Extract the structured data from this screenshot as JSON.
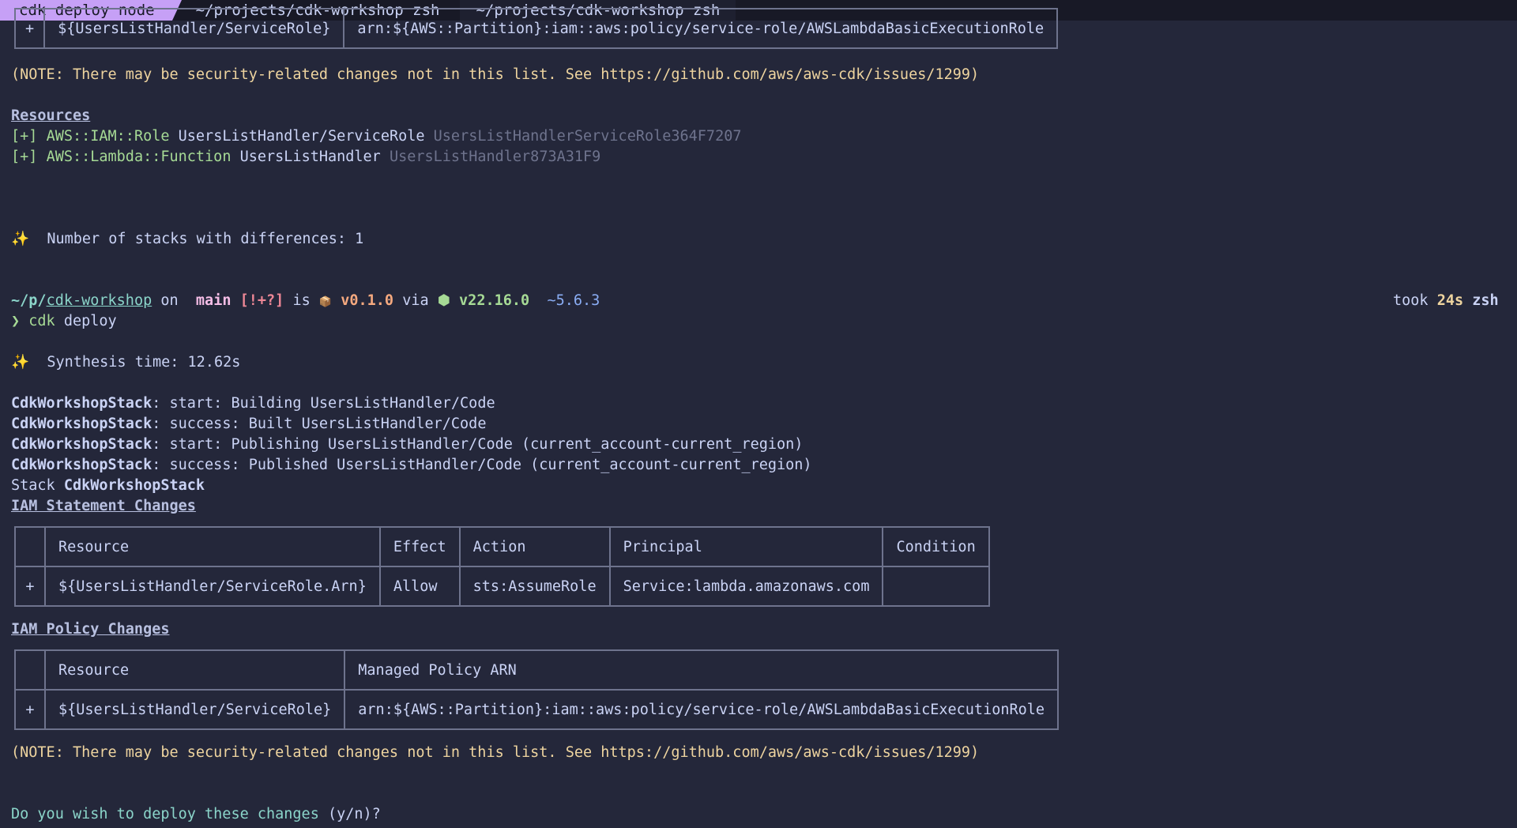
{
  "tabs": [
    {
      "label": "cdk deploy node",
      "active": true
    },
    {
      "label": "~/projects/cdk-workshop zsh",
      "active": false
    },
    {
      "label": "~/projects/cdk-workshop zsh",
      "active": false
    }
  ],
  "top_partial_row": {
    "plus": "+",
    "resource": "${UsersListHandler/ServiceRole}",
    "arn": "arn:${AWS::Partition}:iam::aws:policy/service-role/AWSLambdaBasicExecutionRole"
  },
  "note": "(NOTE: There may be security-related changes not in this list. See https://github.com/aws/aws-cdk/issues/1299)",
  "resources": {
    "heading": "Resources",
    "items": [
      {
        "marker": "[+]",
        "type": "AWS::IAM::Role",
        "name": "UsersListHandler/ServiceRole",
        "logical_id": "UsersListHandlerServiceRole364F7207"
      },
      {
        "marker": "[+]",
        "type": "AWS::Lambda::Function",
        "name": "UsersListHandler",
        "logical_id": "UsersListHandler873A31F9"
      }
    ]
  },
  "stacks_diff": {
    "icon": "✨",
    "text": "Number of stacks with differences: 1"
  },
  "prompt": {
    "dir_prefix": "~/p/",
    "dir_name": "cdk-workshop",
    "on": "on",
    "branch_icon": "",
    "branch": "main",
    "git_status": "[!+?]",
    "is": "is",
    "pkg_icon": "📦",
    "pkg_version": "v0.1.0",
    "via": "via",
    "node_icon": "⬢",
    "node_version": "v22.16.0",
    "ts_icon": "",
    "ts_version": "~5.6.3",
    "took_label": "took",
    "took_value": "24s",
    "shell": "zsh"
  },
  "command": {
    "caret": "❯",
    "cmd": "cdk",
    "args": "deploy"
  },
  "synthesis": {
    "icon": "✨",
    "text": "Synthesis time: 12.62s"
  },
  "log_lines": [
    {
      "stack": "CdkWorkshopStack",
      "text": ": start: Building UsersListHandler/Code"
    },
    {
      "stack": "CdkWorkshopStack",
      "text": ": success: Built UsersListHandler/Code"
    },
    {
      "stack": "CdkWorkshopStack",
      "text": ": start: Publishing UsersListHandler/Code (current_account-current_region)"
    },
    {
      "stack": "CdkWorkshopStack",
      "text": ": success: Published UsersListHandler/Code (current_account-current_region)"
    }
  ],
  "stack_line": {
    "label": "Stack",
    "name": "CdkWorkshopStack"
  },
  "iam_statement": {
    "heading": "IAM Statement Changes",
    "headers": [
      "",
      "Resource",
      "Effect",
      "Action",
      "Principal",
      "Condition"
    ],
    "row": [
      "+",
      "${UsersListHandler/ServiceRole.Arn}",
      "Allow",
      "sts:AssumeRole",
      "Service:lambda.amazonaws.com",
      ""
    ]
  },
  "iam_policy": {
    "heading": "IAM Policy Changes",
    "headers": [
      "",
      "Resource",
      "Managed Policy ARN"
    ],
    "row": [
      "+",
      "${UsersListHandler/ServiceRole}",
      "arn:${AWS::Partition}:iam::aws:policy/service-role/AWSLambdaBasicExecutionRole"
    ]
  },
  "confirm": {
    "question": "Do you wish to deploy these changes",
    "options": "(y/n)?"
  }
}
